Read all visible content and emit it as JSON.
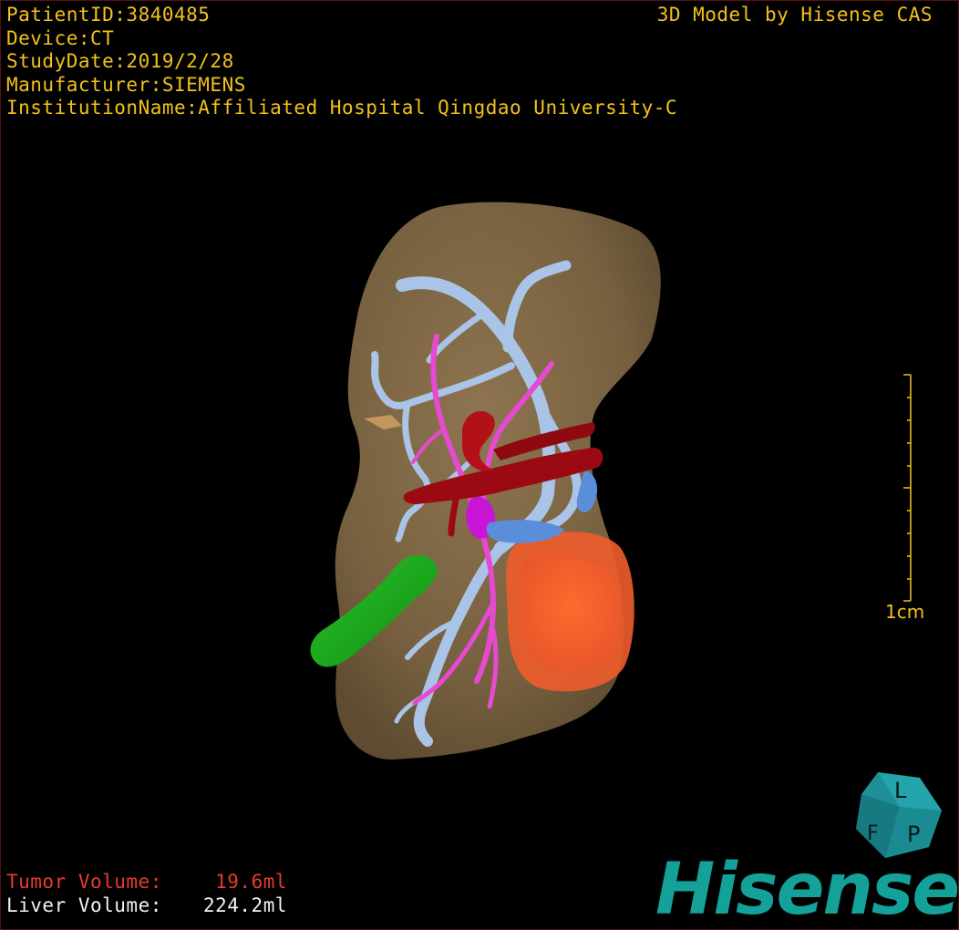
{
  "header": {
    "patient_id": "PatientID:3840485",
    "device": "Device:CT",
    "study_date": "StudyDate:2019/2/28",
    "manufacturer": "Manufacturer:SIEMENS",
    "institution": "InstitutionName:Affiliated Hospital Qingdao University-C"
  },
  "vendor_label": "3D Model by Hisense CAS",
  "volumes": {
    "tumor_label": "Tumor Volume:",
    "tumor_value": "19.6ml",
    "liver_label": "Liver Volume:",
    "liver_value": "224.2ml"
  },
  "scale_bar": {
    "label": "1cm"
  },
  "orientation_cube": {
    "faces": [
      "L",
      "P",
      "F"
    ]
  },
  "brand": "Hisense",
  "colors": {
    "overlay_text": "#f2c11a",
    "tumor_text": "#e83a2a",
    "liver": "#7d6444",
    "portal_vein": "#a9c4e6",
    "hepatic_artery": "#e54ad0",
    "artery_trunk": "#9b0a12",
    "tumor": "#ff6a33",
    "gallbladder": "#17a817",
    "brand": "#14a19a"
  }
}
